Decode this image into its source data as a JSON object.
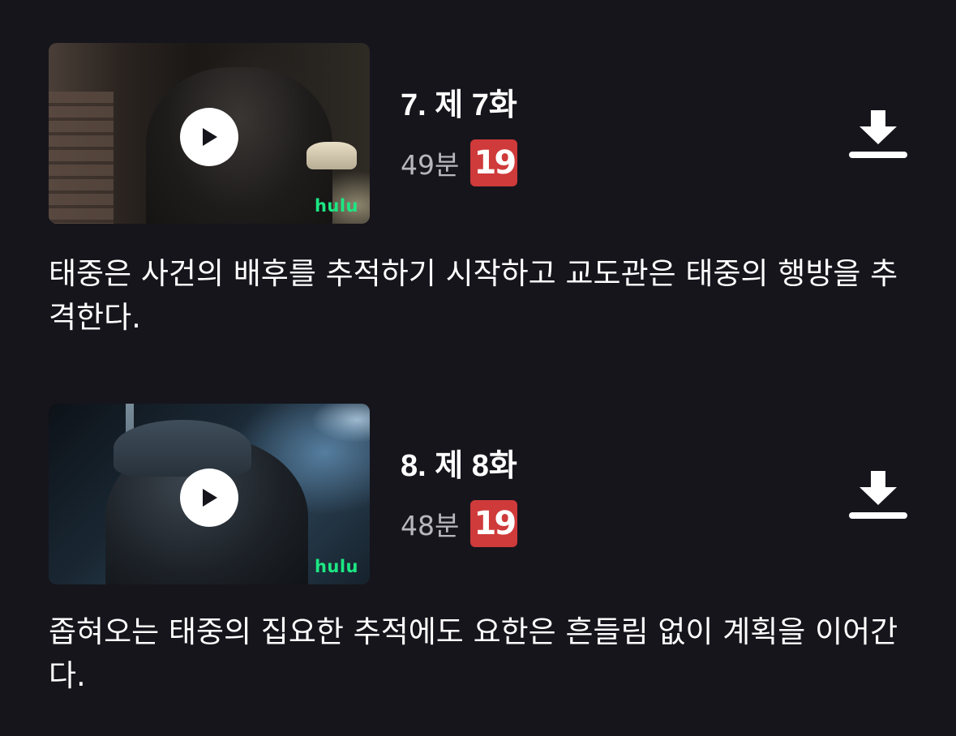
{
  "episodes": [
    {
      "title": "7. 제 7화",
      "duration": "49분",
      "rating": "19",
      "network_logo": "hulu",
      "play_icon": "play-icon",
      "download_icon": "download-icon",
      "description": "태중은 사건의 배후를 추적하기 시작하고 교도관은 태중의 행방을 추격한다."
    },
    {
      "title": "8. 제 8화",
      "duration": "48분",
      "rating": "19",
      "network_logo": "hulu",
      "play_icon": "play-icon",
      "download_icon": "download-icon",
      "description": "좁혀오는 태중의 집요한 추적에도 요한은 흔들림 없이 계획을 이어간다."
    }
  ],
  "colors": {
    "background": "#16151c",
    "rating_badge": "#cf3a3a",
    "network_logo": "#1ce783",
    "secondary_text": "#b7b7bd"
  }
}
